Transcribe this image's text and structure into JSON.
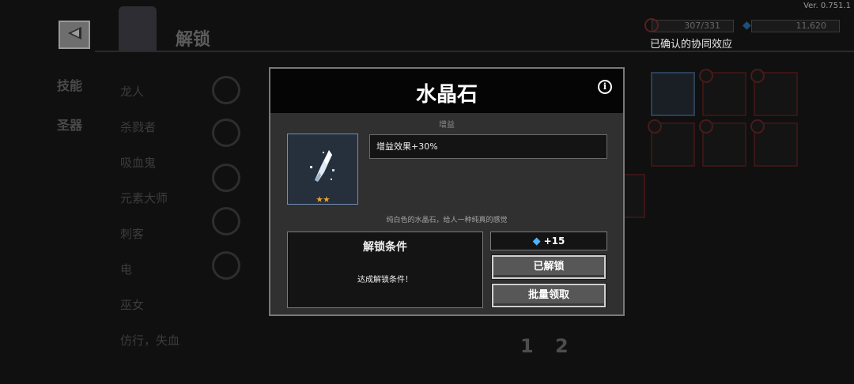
{
  "version": "Ver. 0.751.1",
  "header": {
    "title": "解锁",
    "resource_1": "307/331",
    "resource_2": "11,620",
    "synergy_label": "已确认的协同效应"
  },
  "sidebar": {
    "tabs": [
      {
        "label": "技能"
      },
      {
        "label": "圣器"
      }
    ]
  },
  "class_list": [
    "龙人",
    "杀戮者",
    "吸血鬼",
    "元素大师",
    "刺客",
    "电",
    "巫女",
    "仿行，失血"
  ],
  "pagination": [
    "1",
    "2"
  ],
  "dialog": {
    "title": "水晶石",
    "category": "增益",
    "effect": "增益效果+30%",
    "description": "纯白色的水晶石，给人一种纯真的感觉",
    "stars": "★★",
    "unlock_condition_title": "解锁条件",
    "unlock_condition_text": "达成解锁条件！",
    "reward": "+15",
    "unlocked_button": "已解锁",
    "batch_claim_button": "批量领取"
  },
  "icons": {
    "back": "back-arrow-icon",
    "info": "info-icon",
    "gem": "gem-icon",
    "item": "crystal-stone-icon"
  },
  "colors": {
    "gem": "#4fb3ff",
    "star": "#e8a23a",
    "item_frame_border": "#6f8fb4"
  }
}
